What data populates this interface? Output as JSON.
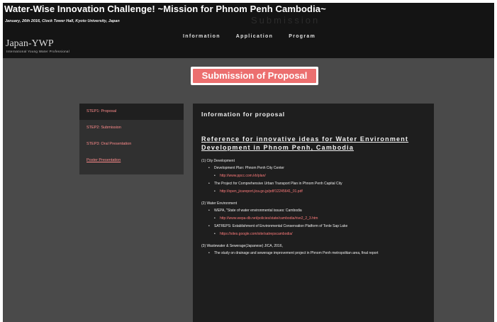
{
  "header": {
    "title": "Water-Wise Innovation Challenge! ~Mission for Phnom Penh Cambodia~",
    "subtitle": "January, 26th 2016, Clock Tower Hall, Kyoto University, Japan",
    "ghost_text": "Submission"
  },
  "logo": {
    "name": "Japan-YWP",
    "tagline": "International Young Water Professional"
  },
  "nav": [
    "Information",
    "Application",
    "Program"
  ],
  "page_heading": "Submission of Proposal",
  "sidebar": [
    {
      "label": "STEP1: Proposal",
      "state": "active"
    },
    {
      "label": "STEP2: Submission",
      "state": "normal"
    },
    {
      "label": "STEP3: Oral Presentation",
      "state": "normal"
    },
    {
      "label": "Poster Presentation",
      "state": "underlined"
    }
  ],
  "main": {
    "heading": "Information for proposal",
    "reference_heading": "Reference for innovative ideas for Water Environment Development in Phnom Penh, Cambodia",
    "sections": [
      {
        "title": "(1) City Development",
        "items": [
          {
            "text": "Development Plan: Phnom Penh City Center"
          },
          {
            "text": "http://www.ppcc.com.kh/plan/",
            "link": true
          },
          {
            "text": "The Project for Comprehensive Urban Transport Plan in Phnom Penh Capital City"
          },
          {
            "text": "http://open_jicareport.jica.go.jp/pdf/12245641_01.pdf",
            "link": true
          }
        ]
      },
      {
        "title": "(2) Water Environment",
        "items": [
          {
            "text": "WEPA, \"State of water environmental issues: Cambodia"
          },
          {
            "text": "http://www.wepa-db.net/policies/state/cambodia/rive2_2_3.htm",
            "link": true
          },
          {
            "text": "SATREPS: Establishment of Environmental Conservation Platform of Tonle Sap Lake"
          },
          {
            "text": "https://sites.google.com/site/satrepscambodia/",
            "link": true
          }
        ]
      },
      {
        "title": "(3) Wastewater & Sewerage(Japanese) JICA, 2016,",
        "items": [
          {
            "text": "The study on drainage and sewerage improvement project in Phnom Penh metropolitan area, final report"
          }
        ]
      }
    ]
  },
  "colors": {
    "page_background": "#141414",
    "content_background": "#4a4a4a",
    "accent_red": "#ec6f6f",
    "link_red": "#ff7b7b"
  }
}
